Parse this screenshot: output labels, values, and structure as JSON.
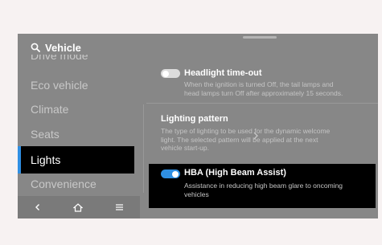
{
  "header": {
    "title": "Vehicle"
  },
  "nav": {
    "items": [
      {
        "label": "Drive mode"
      },
      {
        "label": "Eco vehicle"
      },
      {
        "label": "Climate"
      },
      {
        "label": "Seats"
      },
      {
        "label": "Lights"
      },
      {
        "label": "Convenience"
      }
    ],
    "active_index": 4
  },
  "bottom_bar": {
    "icons": [
      "back-icon",
      "home-icon",
      "menu-icon"
    ]
  },
  "settings": {
    "headlight_timeout": {
      "title": "Headlight time-out",
      "description_line1": "When the ignition is turned Off, the tail lamps and",
      "description_line2": "head lamps turn Off after approximately 15 seconds.",
      "enabled": false
    },
    "lighting_pattern": {
      "title": "Lighting pattern",
      "description_line1": "The type of lighting to be used for the dynamic welcome",
      "description_line2": "light. The selected pattern will be applied at the next",
      "description_line3": "vehicle start-up."
    },
    "hba": {
      "title": "HBA (High Beam Assist)",
      "description_line1": "Assistance in reducing high beam glare to oncoming",
      "description_line2": "vehicles",
      "enabled": true
    }
  },
  "colors": {
    "accent": "#2f8fe3",
    "panel": "#878787",
    "active_bg": "#000000"
  }
}
